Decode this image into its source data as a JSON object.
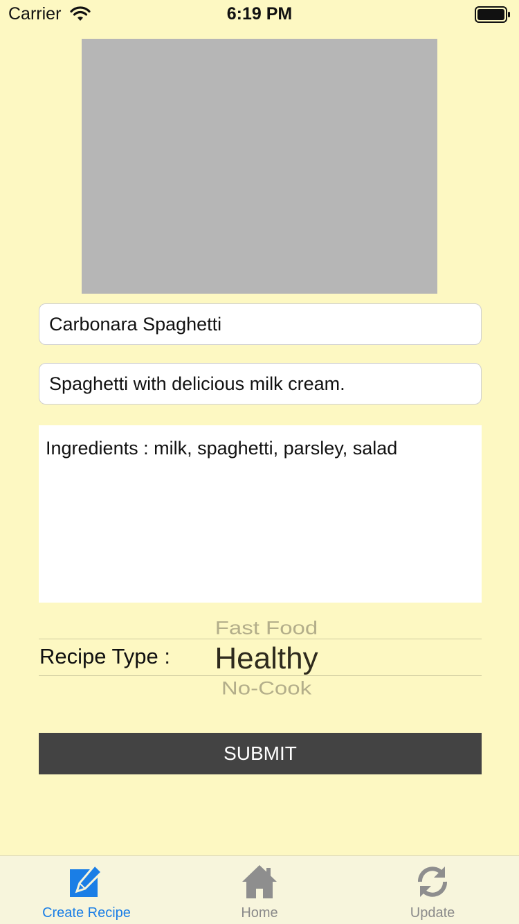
{
  "status_bar": {
    "carrier": "Carrier",
    "time": "6:19 PM",
    "wifi_icon": "wifi-icon",
    "battery_icon": "battery-icon"
  },
  "form": {
    "recipe_name_value": "Carbonara Spaghetti",
    "description_value": "Spaghetti with delicious milk cream.",
    "ingredients_value": "Ingredients : milk, spaghetti, parsley, salad"
  },
  "picker": {
    "label": "Recipe Type :",
    "previous_option": "Fast Food",
    "selected_option": "Healthy",
    "next_option": "No-Cook"
  },
  "submit_label": "SUBMIT",
  "tab_bar": {
    "tabs": [
      {
        "label": "Create Recipe",
        "icon": "edit-icon",
        "active": true
      },
      {
        "label": "Home",
        "icon": "home-icon",
        "active": false
      },
      {
        "label": "Update",
        "icon": "refresh-icon",
        "active": false
      }
    ]
  },
  "colors": {
    "background": "#fdf8c2",
    "accent": "#1a7ee6",
    "button": "#434343",
    "placeholder_image": "#b6b6b6"
  }
}
